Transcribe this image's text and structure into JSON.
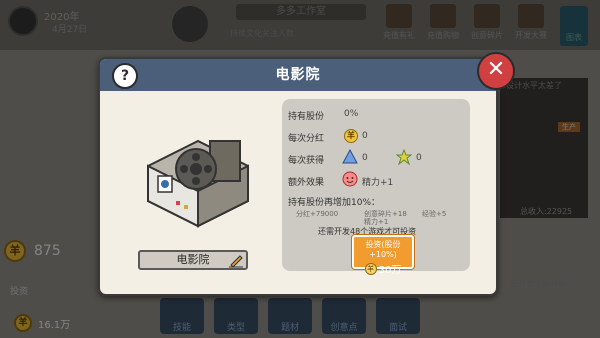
{
  "background": {
    "year": "2020年",
    "date": "4月27日",
    "studio_name": "多多工作室",
    "studio_sub": "持续文化关注人数",
    "top_buttons": [
      "充值有礼",
      "充值购物",
      "创意碎片",
      "开发大赛"
    ],
    "side_tab": "图表",
    "coins": "875",
    "invest_label": "投资",
    "bottom_money": "16.1万",
    "bottom_buttons": [
      "技能",
      "类型",
      "题材",
      "创意点",
      "面试"
    ],
    "right_label": "设计水平太差了",
    "right_tag": "生产",
    "right_income": "总收入:22925",
    "right_hint": "在开发主题开始"
  },
  "dialog": {
    "title": "电影院",
    "help": "?",
    "building_name": "电影院",
    "rows": {
      "shares_label": "持有股份",
      "shares_value": "0%",
      "dividend_label": "每次分红",
      "dividend_value": "0",
      "gain_label": "每次获得",
      "gain_value_a": "0",
      "gain_value_b": "0",
      "extra_label": "额外效果",
      "extra_value": "精力+1"
    },
    "increase_title": "持有股份再增加10%：",
    "increase_line1_a": "分红+79000",
    "increase_line1_b": "创意碎片+18",
    "increase_line1_c": "经验+5",
    "increase_line2": "精力+1",
    "requirement": "还需开发48个游戏才可投资",
    "invest_button": {
      "line1": "投资(股份+10%)",
      "price": "30万"
    }
  },
  "colors": {
    "header": "#4b5f7a",
    "dialog_bg": "#f3efe4",
    "panel_bg": "#cdcac3",
    "invest_btn": "#f29b2e",
    "close_btn": "#d04040",
    "coin": "#e7b93a"
  }
}
